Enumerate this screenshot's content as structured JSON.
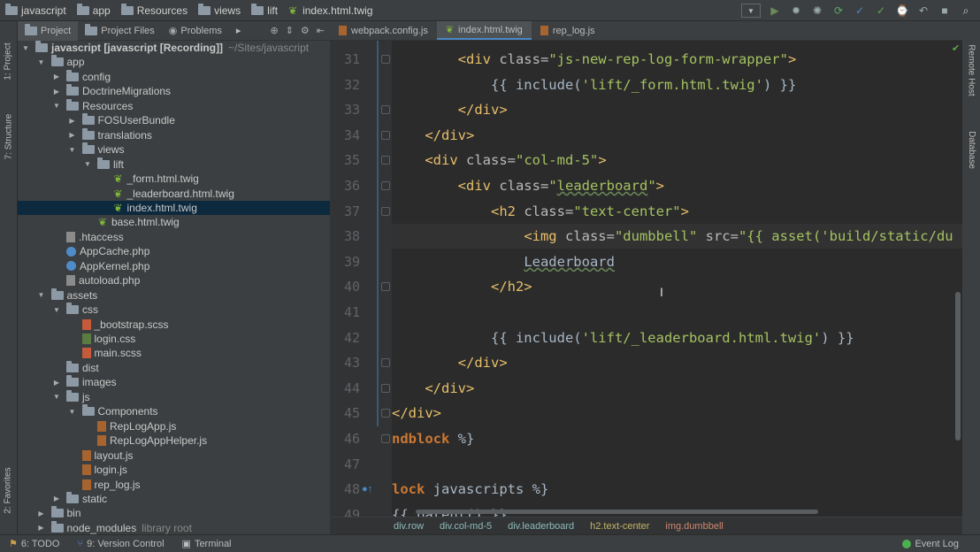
{
  "breadcrumbs": [
    "javascript",
    "app",
    "Resources",
    "views",
    "lift",
    "index.html.twig"
  ],
  "left_tabs": [
    "1: Project",
    "7: Structure",
    "2: Favorites"
  ],
  "right_tabs": [
    "Remote Host",
    "Database"
  ],
  "project_toolbar": {
    "tabs": [
      "Project",
      "Project Files",
      "Problems"
    ]
  },
  "tree": [
    {
      "label": "javascript [javascript [Recording]]",
      "note": "~/Sites/javascript",
      "indent": 0,
      "arrow": "▼",
      "icon": "folder"
    },
    {
      "label": "app",
      "indent": 1,
      "arrow": "▼",
      "icon": "folder"
    },
    {
      "label": "config",
      "indent": 2,
      "arrow": "▶",
      "icon": "folder"
    },
    {
      "label": "DoctrineMigrations",
      "indent": 2,
      "arrow": "▶",
      "icon": "folder"
    },
    {
      "label": "Resources",
      "indent": 2,
      "arrow": "▼",
      "icon": "folder"
    },
    {
      "label": "FOSUserBundle",
      "indent": 3,
      "arrow": "▶",
      "icon": "folder"
    },
    {
      "label": "translations",
      "indent": 3,
      "arrow": "▶",
      "icon": "folder"
    },
    {
      "label": "views",
      "indent": 3,
      "arrow": "▼",
      "icon": "folder"
    },
    {
      "label": "lift",
      "indent": 4,
      "arrow": "▼",
      "icon": "folder"
    },
    {
      "label": "_form.html.twig",
      "indent": 5,
      "arrow": "",
      "icon": "twig"
    },
    {
      "label": "_leaderboard.html.twig",
      "indent": 5,
      "arrow": "",
      "icon": "twig"
    },
    {
      "label": "index.html.twig",
      "indent": 5,
      "arrow": "",
      "icon": "twig",
      "selected": true
    },
    {
      "label": "base.html.twig",
      "indent": 4,
      "arrow": "",
      "icon": "twig"
    },
    {
      "label": ".htaccess",
      "indent": 2,
      "arrow": "",
      "icon": "file"
    },
    {
      "label": "AppCache.php",
      "indent": 2,
      "arrow": "",
      "icon": "php"
    },
    {
      "label": "AppKernel.php",
      "indent": 2,
      "arrow": "",
      "icon": "php"
    },
    {
      "label": "autoload.php",
      "indent": 2,
      "arrow": "",
      "icon": "file"
    },
    {
      "label": "assets",
      "indent": 1,
      "arrow": "▼",
      "icon": "folder"
    },
    {
      "label": "css",
      "indent": 2,
      "arrow": "▼",
      "icon": "folder"
    },
    {
      "label": "_bootstrap.scss",
      "indent": 3,
      "arrow": "",
      "icon": "scss"
    },
    {
      "label": "login.css",
      "indent": 3,
      "arrow": "",
      "icon": "css"
    },
    {
      "label": "main.scss",
      "indent": 3,
      "arrow": "",
      "icon": "scss"
    },
    {
      "label": "dist",
      "indent": 2,
      "arrow": "",
      "icon": "folder"
    },
    {
      "label": "images",
      "indent": 2,
      "arrow": "▶",
      "icon": "folder"
    },
    {
      "label": "js",
      "indent": 2,
      "arrow": "▼",
      "icon": "folder"
    },
    {
      "label": "Components",
      "indent": 3,
      "arrow": "▼",
      "icon": "folder"
    },
    {
      "label": "RepLogApp.js",
      "indent": 4,
      "arrow": "",
      "icon": "js"
    },
    {
      "label": "RepLogAppHelper.js",
      "indent": 4,
      "arrow": "",
      "icon": "js"
    },
    {
      "label": "layout.js",
      "indent": 3,
      "arrow": "",
      "icon": "js"
    },
    {
      "label": "login.js",
      "indent": 3,
      "arrow": "",
      "icon": "js"
    },
    {
      "label": "rep_log.js",
      "indent": 3,
      "arrow": "",
      "icon": "js"
    },
    {
      "label": "static",
      "indent": 2,
      "arrow": "▶",
      "icon": "folder"
    },
    {
      "label": "bin",
      "indent": 1,
      "arrow": "▶",
      "icon": "folder"
    },
    {
      "label": "node_modules",
      "note": "library root",
      "indent": 1,
      "arrow": "▶",
      "icon": "folder"
    }
  ],
  "editor_tabs": [
    {
      "label": "webpack.config.js",
      "icon": "js",
      "active": false
    },
    {
      "label": "index.html.twig",
      "icon": "twig",
      "active": true
    },
    {
      "label": "rep_log.js",
      "icon": "js",
      "active": false
    }
  ],
  "line_numbers": [
    "31",
    "32",
    "33",
    "34",
    "35",
    "36",
    "37",
    "38",
    "39",
    "40",
    "41",
    "42",
    "43",
    "44",
    "45",
    "46",
    "47",
    "48",
    "49"
  ],
  "code_lines": [
    [
      {
        "t": "        ",
        "c": "plain"
      },
      {
        "t": "<div",
        "c": "tag"
      },
      {
        "t": " class=",
        "c": "attr"
      },
      {
        "t": "\"js-new-rep-log-form-wrapper\"",
        "c": "str"
      },
      {
        "t": ">",
        "c": "tag"
      }
    ],
    [
      {
        "t": "            {{ include(",
        "c": "plain"
      },
      {
        "t": "'lift/_form.html.twig'",
        "c": "str"
      },
      {
        "t": ") }}",
        "c": "plain"
      }
    ],
    [
      {
        "t": "        ",
        "c": "plain"
      },
      {
        "t": "</div>",
        "c": "tag"
      }
    ],
    [
      {
        "t": "    ",
        "c": "plain"
      },
      {
        "t": "</div>",
        "c": "tag"
      }
    ],
    [
      {
        "t": "    ",
        "c": "plain"
      },
      {
        "t": "<div",
        "c": "tag"
      },
      {
        "t": " class=",
        "c": "attr"
      },
      {
        "t": "\"col-md-5\"",
        "c": "str"
      },
      {
        "t": ">",
        "c": "tag"
      }
    ],
    [
      {
        "t": "        ",
        "c": "plain"
      },
      {
        "t": "<div",
        "c": "tag"
      },
      {
        "t": " class=",
        "c": "attr"
      },
      {
        "t": "\"",
        "c": "str"
      },
      {
        "t": "leaderboard",
        "c": "str wavy"
      },
      {
        "t": "\"",
        "c": "str"
      },
      {
        "t": ">",
        "c": "tag"
      }
    ],
    [
      {
        "t": "            ",
        "c": "plain"
      },
      {
        "t": "<h2",
        "c": "tag"
      },
      {
        "t": " class=",
        "c": "attr"
      },
      {
        "t": "\"text-center\"",
        "c": "str"
      },
      {
        "t": ">",
        "c": "tag"
      }
    ],
    [
      {
        "t": "                ",
        "c": "plain"
      },
      {
        "t": "<img",
        "c": "tag"
      },
      {
        "t": " class=",
        "c": "attr"
      },
      {
        "t": "\"dumbbell\"",
        "c": "str"
      },
      {
        "t": " src=",
        "c": "attr"
      },
      {
        "t": "\"{{ asset(",
        "c": "str"
      },
      {
        "t": "'build/static/du",
        "c": "str"
      }
    ],
    [
      {
        "t": "                ",
        "c": "plain"
      },
      {
        "t": "Leaderboard",
        "c": "plain wavy"
      }
    ],
    [
      {
        "t": "            ",
        "c": "plain"
      },
      {
        "t": "</h2>",
        "c": "tag"
      }
    ],
    [
      {
        "t": "",
        "c": "plain"
      }
    ],
    [
      {
        "t": "            {{ include(",
        "c": "plain"
      },
      {
        "t": "'lift/_leaderboard.html.twig'",
        "c": "str"
      },
      {
        "t": ") }}",
        "c": "plain"
      }
    ],
    [
      {
        "t": "        ",
        "c": "plain"
      },
      {
        "t": "</div>",
        "c": "tag"
      }
    ],
    [
      {
        "t": "    ",
        "c": "plain"
      },
      {
        "t": "</div>",
        "c": "tag"
      }
    ],
    [
      {
        "t": "</div>",
        "c": "tag"
      }
    ],
    [
      {
        "t": "ndblock",
        "c": "kw"
      },
      {
        "t": " %}",
        "c": "plain"
      }
    ],
    [
      {
        "t": "",
        "c": "plain"
      }
    ],
    [
      {
        "t": "lock",
        "c": "kw"
      },
      {
        "t": " javascripts %}",
        "c": "plain"
      }
    ],
    [
      {
        "t": "{{ parent() }}",
        "c": "plain"
      }
    ]
  ],
  "editor_breadcrumbs": [
    "div.row",
    "div.col-md-5",
    "div.leaderboard",
    "h2.text-center",
    "img.dumbbell"
  ],
  "status": {
    "todo": "6: TODO",
    "vcs": "9: Version Control",
    "terminal": "Terminal",
    "event_log": "Event Log"
  }
}
